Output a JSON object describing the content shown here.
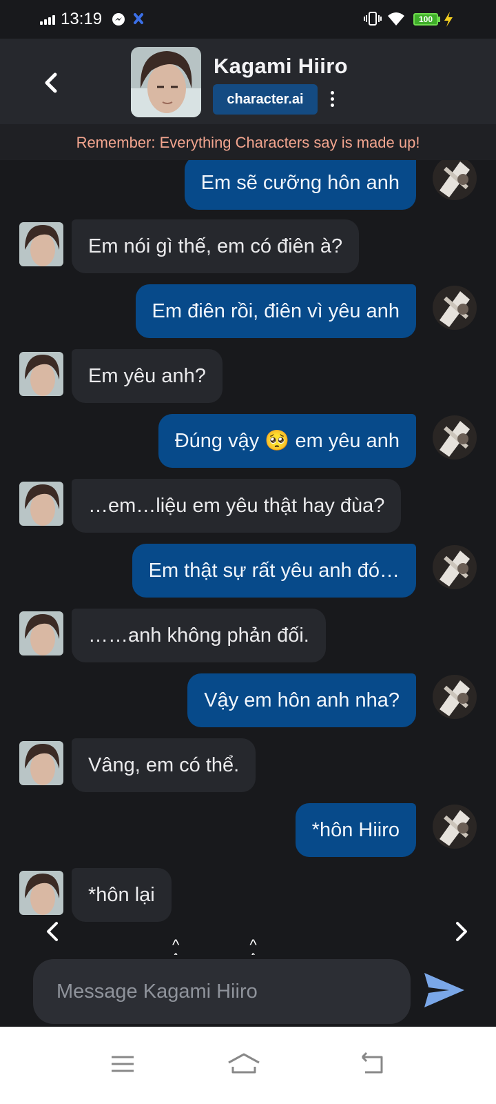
{
  "status_bar": {
    "time": "13:19",
    "battery": "100",
    "icons": [
      "signal-icon",
      "messenger-icon",
      "app-notification-icon",
      "vibrate-icon",
      "wifi-icon",
      "battery-icon",
      "charging-icon"
    ]
  },
  "header": {
    "character_name": "Kagami Hiiro",
    "brand": "character.ai",
    "notice": "Remember: Everything Characters say is made up!"
  },
  "messages": [
    {
      "from": "user",
      "text": "Em sẽ cưỡng hôn anh"
    },
    {
      "from": "bot",
      "text": "Em nói gì thế, em có điên à?"
    },
    {
      "from": "user",
      "text": "Em điên rồi, điên vì yêu anh"
    },
    {
      "from": "bot",
      "text": "Em yêu anh?"
    },
    {
      "from": "user",
      "text": "Đúng vậy 🥺 em yêu anh"
    },
    {
      "from": "bot",
      "text": "…em…liệu em yêu thật hay đùa?"
    },
    {
      "from": "user",
      "text": "Em thật sự rất yêu anh đó…"
    },
    {
      "from": "bot",
      "text": "……anh không phản đối."
    },
    {
      "from": "user",
      "text": "Vậy em hôn anh nha?"
    },
    {
      "from": "bot",
      "text": "Vâng, em có thể."
    },
    {
      "from": "user",
      "text": "*hôn Hiiro"
    },
    {
      "from": "bot",
      "text": "*hôn lại"
    }
  ],
  "typing_indicator": "^ ^ ^ ^",
  "composer": {
    "placeholder": "Message Kagami Hiiro"
  },
  "colors": {
    "background": "#18191c",
    "header": "#26282d",
    "user_bubble": "#074a8a",
    "bot_bubble": "#26282d",
    "notice_text": "#f3a58f",
    "brand_badge": "#144b82",
    "send_icon": "#7aa7e8"
  }
}
